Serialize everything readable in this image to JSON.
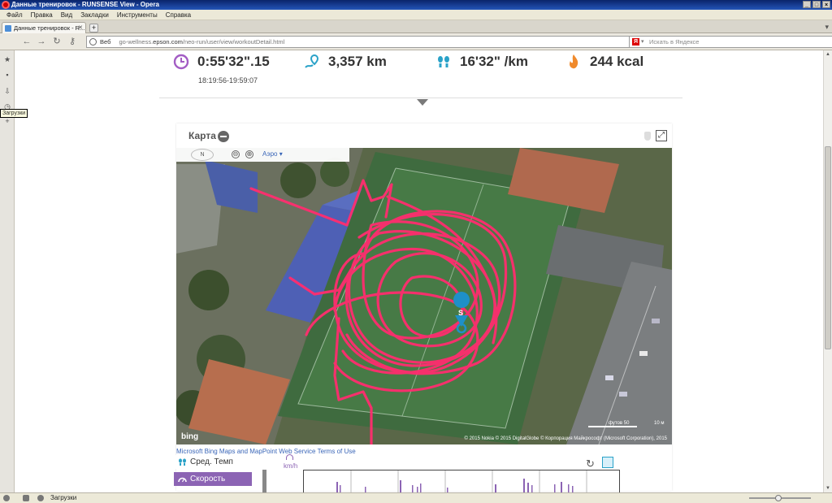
{
  "window": {
    "title": "Данные тренировок - RUNSENSE View - Opera",
    "buttons": [
      "_",
      "□",
      "×"
    ]
  },
  "menu": [
    "Файл",
    "Правка",
    "Вид",
    "Закладки",
    "Инструменты",
    "Справка"
  ],
  "tabs": [
    {
      "label": "Данные тренировок - R..."
    }
  ],
  "address": {
    "web_label": "Веб",
    "url_prefix": "go-wellness.",
    "url_domain": "epson.com",
    "url_path": "/neo-run/user/view/workoutDetail.html",
    "search_placeholder": "Искать в Яндексе",
    "search_engine_letter": "Я"
  },
  "sidebar": {
    "tooltip": "Загрузки"
  },
  "stats": {
    "time": "0:55'32\".15",
    "time_range": "18:19:56-19:59:07",
    "distance": "3,357 km",
    "pace": "16'32\" /km",
    "calories": "244 kcal"
  },
  "map": {
    "title": "Карта",
    "compass_label": "N",
    "zoom_out": "⊖",
    "zoom_in": "⊕",
    "view_mode": "Аэро ▾",
    "bing_label": "bing",
    "start_marker": "S",
    "copyright": "© 2015 Nokia   © 2015 DigitalGlobe   © Корпорация Майкрософт (Microsoft Corporation), 2015",
    "scale_feet": "футов 50",
    "scale_m": "10 м",
    "terms": "Microsoft Bing Maps and MapPoint Web Service Terms of Use"
  },
  "metrics": {
    "buttons": [
      {
        "label": "Сред. Темп",
        "active": false
      },
      {
        "label": "Скорость",
        "active": true
      }
    ],
    "unit": "km/h"
  },
  "statusbar": {
    "label": "Загрузки"
  },
  "colors": {
    "accent": "#8c64b4",
    "route": "#ff2d6f",
    "time_icon": "#a35dc4",
    "distance_icon": "#2aa2c8",
    "calorie_icon": "#f08a2c"
  }
}
